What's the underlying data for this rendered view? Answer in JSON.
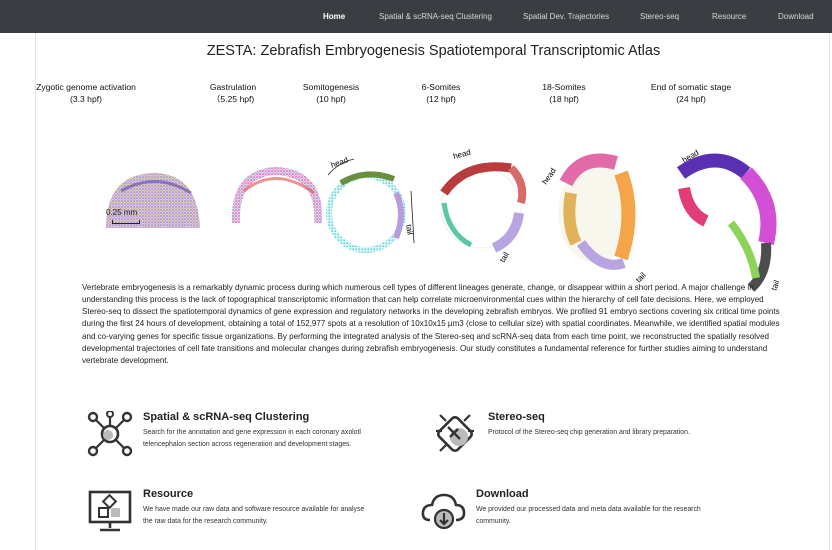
{
  "nav": {
    "items": [
      {
        "label": "Home",
        "active": true
      },
      {
        "label": "Spatial & scRNA-seq Clustering",
        "active": false
      },
      {
        "label": "Spatial Dev. Trajectories",
        "active": false
      },
      {
        "label": "Stereo-seq",
        "active": false
      },
      {
        "label": "Resource",
        "active": false
      },
      {
        "label": "Download",
        "active": false
      }
    ]
  },
  "page_title": "ZESTA: Zebrafish Embryogenesis Spatiotemporal Transcriptomic Atlas",
  "stages": [
    {
      "name": "Zygotic genome activation",
      "time": "(3.3 hpf)"
    },
    {
      "name": "Gastrulation",
      "time": "（5.25 hpf)"
    },
    {
      "name": "Somitogenesis",
      "time": "(10 hpf)"
    },
    {
      "name": "6-Somites",
      "time": "(12 hpf)"
    },
    {
      "name": "18-Somites",
      "time": "(18 hpf)"
    },
    {
      "name": "End of somatic stage",
      "time": "(24 hpf)"
    }
  ],
  "figure": {
    "scale_label": "0.25 mm",
    "head_label": "head",
    "tail_label": "tail"
  },
  "abstract": "Vertebrate embryogenesis is a remarkably dynamic process during which numerous cell types of different lineages generate, change, or disappear within a short period. A major challenge in understanding this process is the lack of topographical transcriptomic information that can help correlate microenvironmental cues within the hierarchy of cell fate decisions. Here, we employed Stereo-seq to dissect the spatiotemporal dynamics of gene expression and regulatory networks in the developing zebrafish embryos. We profiled 91 embryo sections covering six critical time points during the first 24 hours of development, obtaining a total of 152,977 spots at a resolution of 10x10x15 μm3 (close to cellular size) with spatial coordinates. Meanwhile, we identified spatial modules and co-varying genes for specific tissue organizations. By performing the integrated analysis of the Stereo-seq and scRNA-seq data from each time point, we reconstructed the spatially resolved developmental trajectories of cell fate transitions and molecular changes during zebrafish embryogenesis. Our study constitutes a fundamental reference for further studies aiming to understand vertebrate development.",
  "cards": [
    {
      "title": "Spatial & scRNA-seq Clustering",
      "desc": "Search for the annotation and gene expression in each coronary axolotl telencephalon section across regeneration and development stages.",
      "icon": "network-cluster-icon"
    },
    {
      "title": "Stereo-seq",
      "desc": "Protocol of the Stereo-seq chip generation and library preparation.",
      "icon": "dna-chip-icon"
    },
    {
      "title": "Resource",
      "desc": "We have made our raw data and software resource available for analyse the raw data for the research community.",
      "icon": "monitor-resource-icon"
    },
    {
      "title": "Download",
      "desc": "We provided our processed data and meta data available for the research community.",
      "icon": "cloud-download-icon"
    }
  ]
}
